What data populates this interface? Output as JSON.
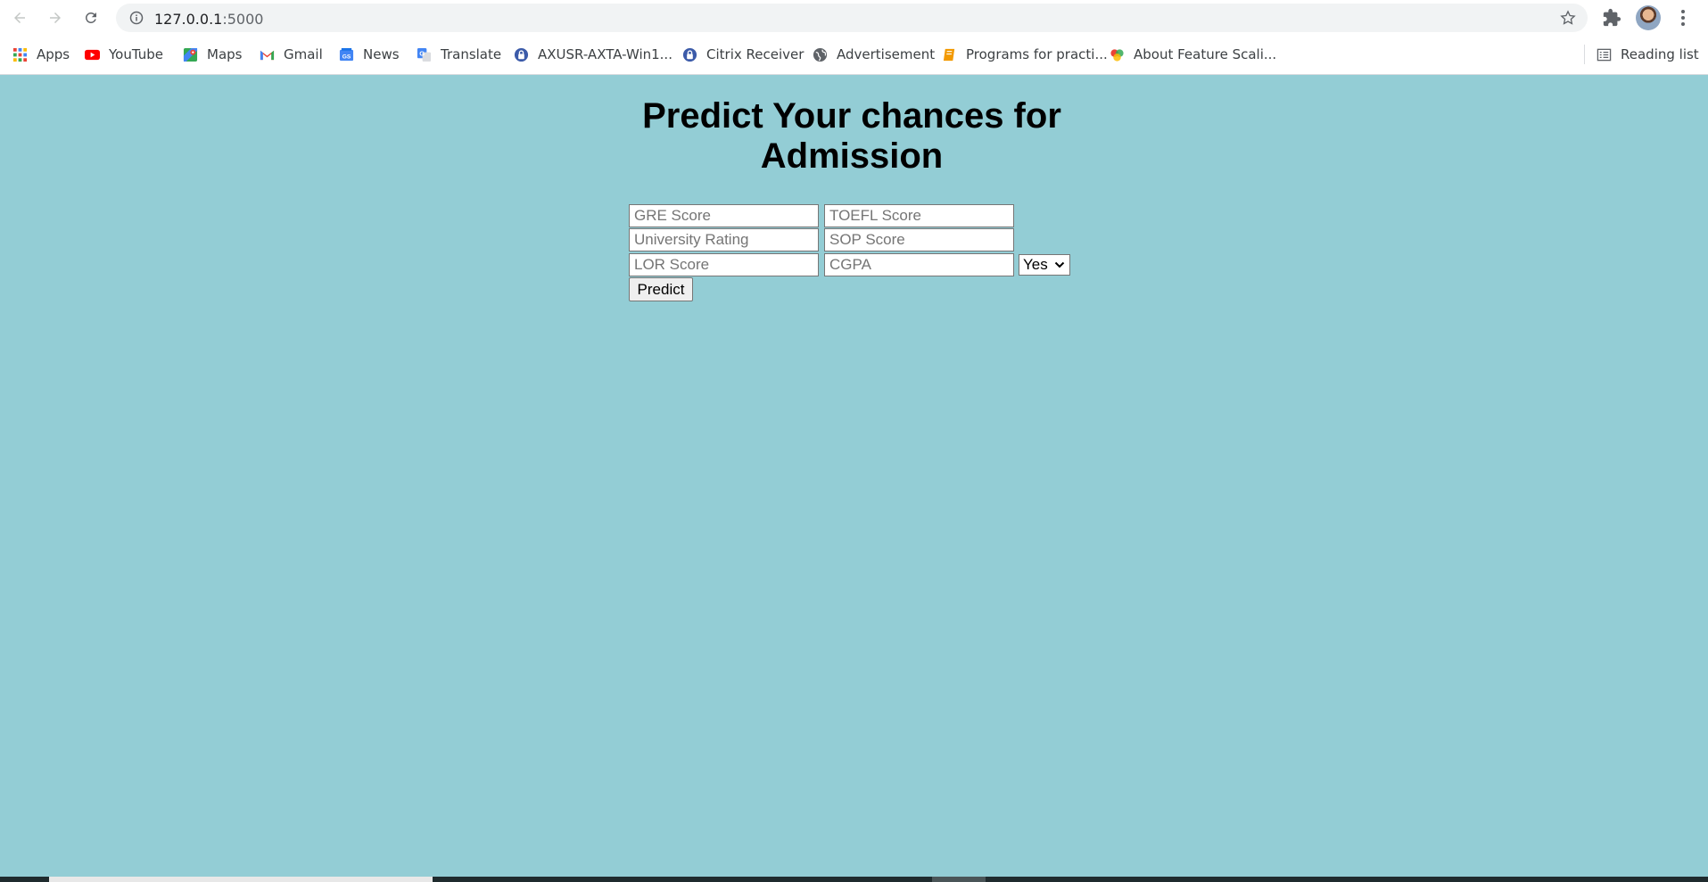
{
  "browser": {
    "url_host": "127.0.0.1",
    "url_port": ":5000",
    "reading_list_label": "Reading list",
    "bookmarks": [
      {
        "label": "Apps",
        "icon": "apps-grid-icon"
      },
      {
        "label": "YouTube",
        "icon": "youtube-icon"
      },
      {
        "label": "Maps",
        "icon": "maps-icon"
      },
      {
        "label": "Gmail",
        "icon": "gmail-icon"
      },
      {
        "label": "News",
        "icon": "news-icon"
      },
      {
        "label": "Translate",
        "icon": "translate-icon"
      },
      {
        "label": "AXUSR-AXTA-Win1...",
        "icon": "lock-icon"
      },
      {
        "label": "Citrix Receiver",
        "icon": "lock-icon"
      },
      {
        "label": "Advertisement",
        "icon": "globe-icon"
      },
      {
        "label": "Programs for practi...",
        "icon": "book-icon"
      },
      {
        "label": "About Feature Scali...",
        "icon": "colorful-logo-icon"
      }
    ]
  },
  "page": {
    "title": "Predict Your chances for Admission",
    "background_color": "#93cdd5",
    "form": {
      "gre_placeholder": "GRE Score",
      "toefl_placeholder": "TOEFL Score",
      "university_placeholder": "University Rating",
      "sop_placeholder": "SOP Score",
      "lor_placeholder": "LOR Score",
      "cgpa_placeholder": "CGPA",
      "research_selected": "Yes",
      "predict_label": "Predict"
    }
  }
}
